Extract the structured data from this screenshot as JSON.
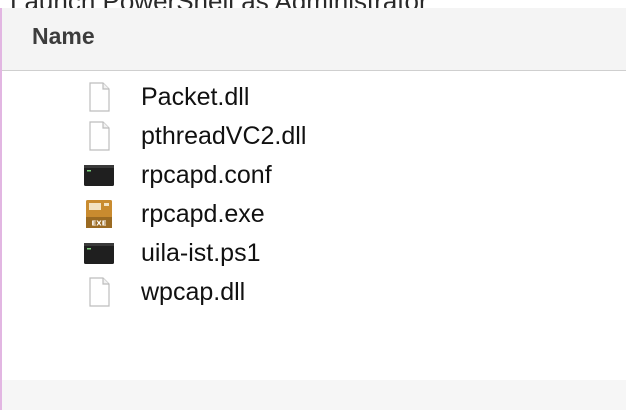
{
  "caption": "Launch PowerShell as Administrator",
  "header": {
    "name_label": "Name"
  },
  "files": [
    {
      "name": "Packet.dll",
      "icon": "document-icon"
    },
    {
      "name": "pthreadVC2.dll",
      "icon": "document-icon"
    },
    {
      "name": "rpcapd.conf",
      "icon": "terminal-icon"
    },
    {
      "name": "rpcapd.exe",
      "icon": "exe-icon"
    },
    {
      "name": "uila-ist.ps1",
      "icon": "terminal-icon"
    },
    {
      "name": "wpcap.dll",
      "icon": "document-icon"
    }
  ],
  "colors": {
    "accent": "#e2b6e2",
    "header_bg": "#f4f4f4",
    "terminal": "#1f1f1f",
    "exe_body": "#c98b2f"
  }
}
